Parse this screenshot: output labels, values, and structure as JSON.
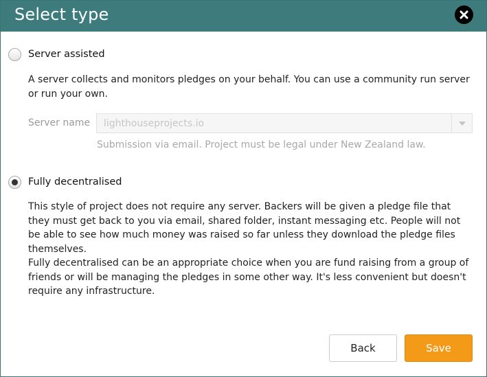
{
  "dialog": {
    "title": "Select type",
    "close_icon": "close-icon"
  },
  "options": {
    "server_assisted": {
      "label": "Server assisted",
      "selected": false,
      "description": "A server collects and monitors pledges on your behalf. You can use a community run server or run your own.",
      "server_name_label": "Server name",
      "server_name_value": "lighthouseprojects.io",
      "server_hint": "Submission via email. Project must be legal under New Zealand law."
    },
    "fully_decentralised": {
      "label": "Fully decentralised",
      "selected": true,
      "description_1": "This style of project does not require any server. Backers will be given a pledge file that they must get back to you via email, shared folder, instant messaging etc. People will not be able to see how much money was raised so far unless they download the pledge files themselves.",
      "description_2": "Fully decentralised can be an appropriate choice when you are fund raising from a group of friends or will be managing the pledges in some other way. It's less convenient but doesn't require any infrastructure."
    }
  },
  "buttons": {
    "back_label": "Back",
    "save_label": "Save"
  },
  "colors": {
    "header": "#3e7b7c",
    "save_button": "#f39a18"
  }
}
